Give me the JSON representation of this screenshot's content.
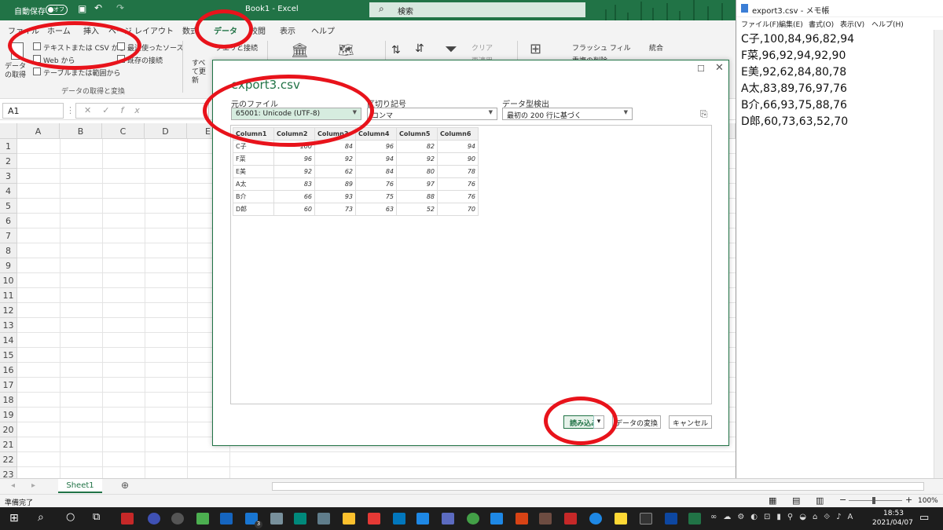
{
  "excel": {
    "title": "Book1 - Excel",
    "autosave_label": "自動保存",
    "autosave_state": "オフ",
    "search_placeholder": "検索",
    "menu": [
      "ファイル",
      "ホーム",
      "挿入",
      "ページ レイアウト",
      "数式",
      "データ",
      "校閲",
      "表示",
      "ヘルプ"
    ],
    "ribbon": {
      "get_data": "データの取得",
      "from_text_csv": "テキストまたは CSV から",
      "from_web": "Web から",
      "from_table": "テーブルまたは範囲から",
      "recent_sources": "最近使ったソース",
      "existing_connections": "既存の接続",
      "group_label": "データの取得と変換",
      "refresh_all": "すべて更新",
      "queries_connections": "クエリと接続",
      "clear": "クリア",
      "reapply": "再適用",
      "flash_fill": "フラッシュ フィル",
      "remove_duplicates": "重複の削除",
      "consolidate": "統合"
    },
    "namebox": "A1",
    "columns": [
      "A",
      "B",
      "C",
      "D",
      "E"
    ],
    "rows": [
      "1",
      "2",
      "3",
      "4",
      "5",
      "6",
      "7",
      "8",
      "9",
      "10",
      "11",
      "12",
      "13",
      "14",
      "15",
      "16",
      "17",
      "18",
      "19",
      "20",
      "21",
      "22",
      "23"
    ],
    "sheet_tab": "Sheet1",
    "status": "準備完了",
    "zoom": "100%"
  },
  "dialog": {
    "title": "export3.csv",
    "origin_label": "元のファイル",
    "origin_value": "65001: Unicode (UTF-8)",
    "delimiter_label": "区切り記号",
    "delimiter_value": "コンマ",
    "detect_label": "データ型検出",
    "detect_value": "最初の 200 行に基づく",
    "headers": [
      "Column1",
      "Column2",
      "Column3",
      "Column4",
      "Column5",
      "Column6"
    ],
    "rows": [
      [
        "C子",
        "100",
        "84",
        "96",
        "82",
        "94"
      ],
      [
        "F菜",
        "96",
        "92",
        "94",
        "92",
        "90"
      ],
      [
        "E美",
        "92",
        "62",
        "84",
        "80",
        "78"
      ],
      [
        "A太",
        "83",
        "89",
        "76",
        "97",
        "76"
      ],
      [
        "B介",
        "66",
        "93",
        "75",
        "88",
        "76"
      ],
      [
        "D郎",
        "60",
        "73",
        "63",
        "52",
        "70"
      ]
    ],
    "load_button": "読み込み",
    "transform_button": "データの変換",
    "cancel_button": "キャンセル"
  },
  "notepad": {
    "title": "export3.csv - メモ帳",
    "menu": [
      "ファイル(F)",
      "編集(E)",
      "書式(O)",
      "表示(V)",
      "ヘルプ(H)"
    ],
    "lines": [
      "C子,100,84,96,82,94",
      "F菜,96,92,94,92,90",
      "E美,92,62,84,80,78",
      "A太,83,89,76,97,76",
      "B介,66,93,75,88,76",
      "D郎,60,73,63,52,70"
    ]
  },
  "taskbar": {
    "time": "18:53",
    "date": "2021/04/07",
    "badge": "3"
  }
}
